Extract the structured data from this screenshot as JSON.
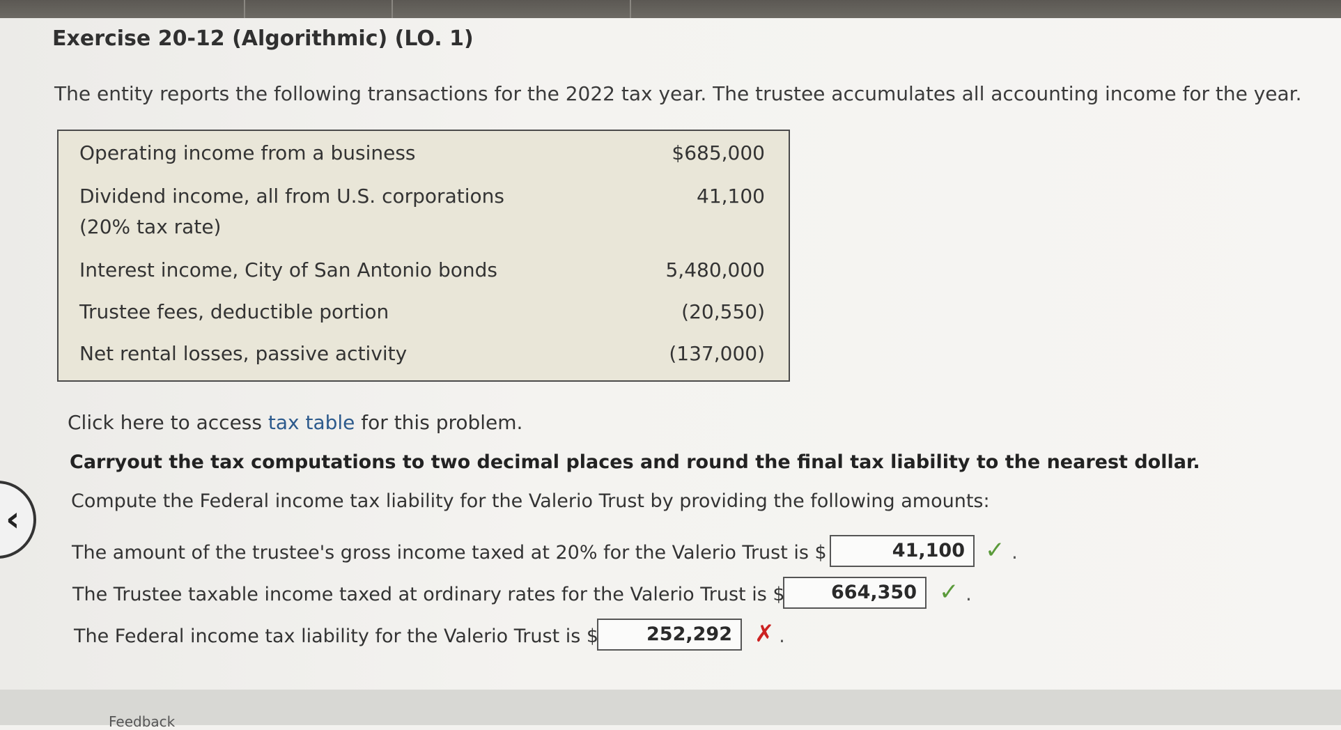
{
  "exercise": {
    "title": "Exercise 20-12 (Algorithmic) (LO. 1)",
    "intro": "The entity reports the following transactions for the 2022 tax year. The trustee accumulates all accounting income for the year."
  },
  "transactions": [
    {
      "label": "Operating income from a business",
      "label2": "",
      "value": "$685,000"
    },
    {
      "label": "Dividend income, all from U.S. corporations",
      "label2": "(20% tax rate)",
      "value": "41,100"
    },
    {
      "label": "Interest income, City of San Antonio bonds",
      "label2": "",
      "value": "5,480,000"
    },
    {
      "label": "Trustee fees, deductible portion",
      "label2": "",
      "value": "(20,550)"
    },
    {
      "label": "Net rental losses, passive activity",
      "label2": "",
      "value": "(137,000)"
    }
  ],
  "links": {
    "prefix": "Click here to access ",
    "link_text": "tax table",
    "suffix": " for this problem."
  },
  "instructions": {
    "bold": "Carryout the tax computations to two decimal places and round the final tax liability to the nearest dollar.",
    "compute": "Compute the Federal income tax liability for the Valerio Trust by providing the following amounts:"
  },
  "answers": [
    {
      "text": "The amount of the trustee's gross income taxed at 20% for the Valerio Trust is $",
      "value": "41,100",
      "status": "correct",
      "mark": "✓"
    },
    {
      "text": "The Trustee taxable income taxed at ordinary rates for the Valerio Trust is $",
      "value": "664,350",
      "status": "correct",
      "mark": "✓"
    },
    {
      "text": "The Federal income tax liability for the Valerio Trust is $",
      "value": "252,292",
      "status": "incorrect",
      "mark": "✗"
    }
  ],
  "footer": {
    "feedback": "Feedback"
  },
  "nav": {
    "back_glyph": "‹"
  },
  "colors": {
    "correct": "#5a9a3a",
    "incorrect": "#cc2222",
    "link": "#2c5a8c",
    "table_bg": "#e9e6d8"
  }
}
